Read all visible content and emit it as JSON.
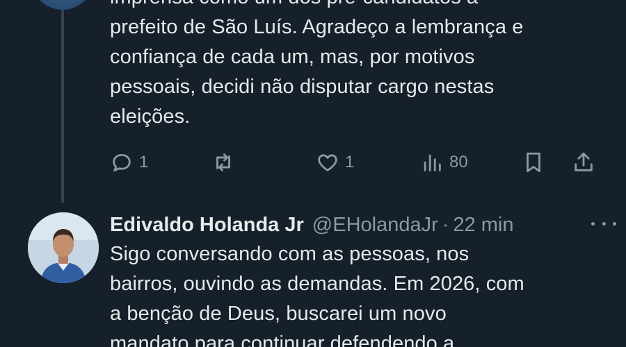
{
  "tweet1": {
    "lines": [
      "imprensa como um dos pré-candidatos a",
      "prefeito de São Luís. Agradeço a lembrança e",
      "confiança de cada um, mas, por motivos",
      "pessoais, decidi não disputar cargo nestas",
      "eleições."
    ],
    "replies": "1",
    "retweets": "",
    "likes": "1",
    "views": "80"
  },
  "tweet2": {
    "display_name": "Edivaldo Holanda Jr",
    "handle": "@EHolandaJr",
    "separator": "·",
    "time": "22 min",
    "lines": [
      "Sigo conversando com as pessoas, nos",
      "bairros, ouvindo as demandas. Em 2026, com",
      "a benção de Deus, buscarei um novo",
      "mandato para continuar defendendo a"
    ]
  },
  "icons": {
    "reply": "reply-icon",
    "retweet": "retweet-icon",
    "like": "heart-icon",
    "views": "views-icon",
    "bookmark": "bookmark-icon",
    "share": "share-icon",
    "more": "more-icon"
  },
  "colors": {
    "background": "#15202b",
    "text": "#e7e9ea",
    "muted": "#8b98a5",
    "thread_line": "#38444d"
  }
}
